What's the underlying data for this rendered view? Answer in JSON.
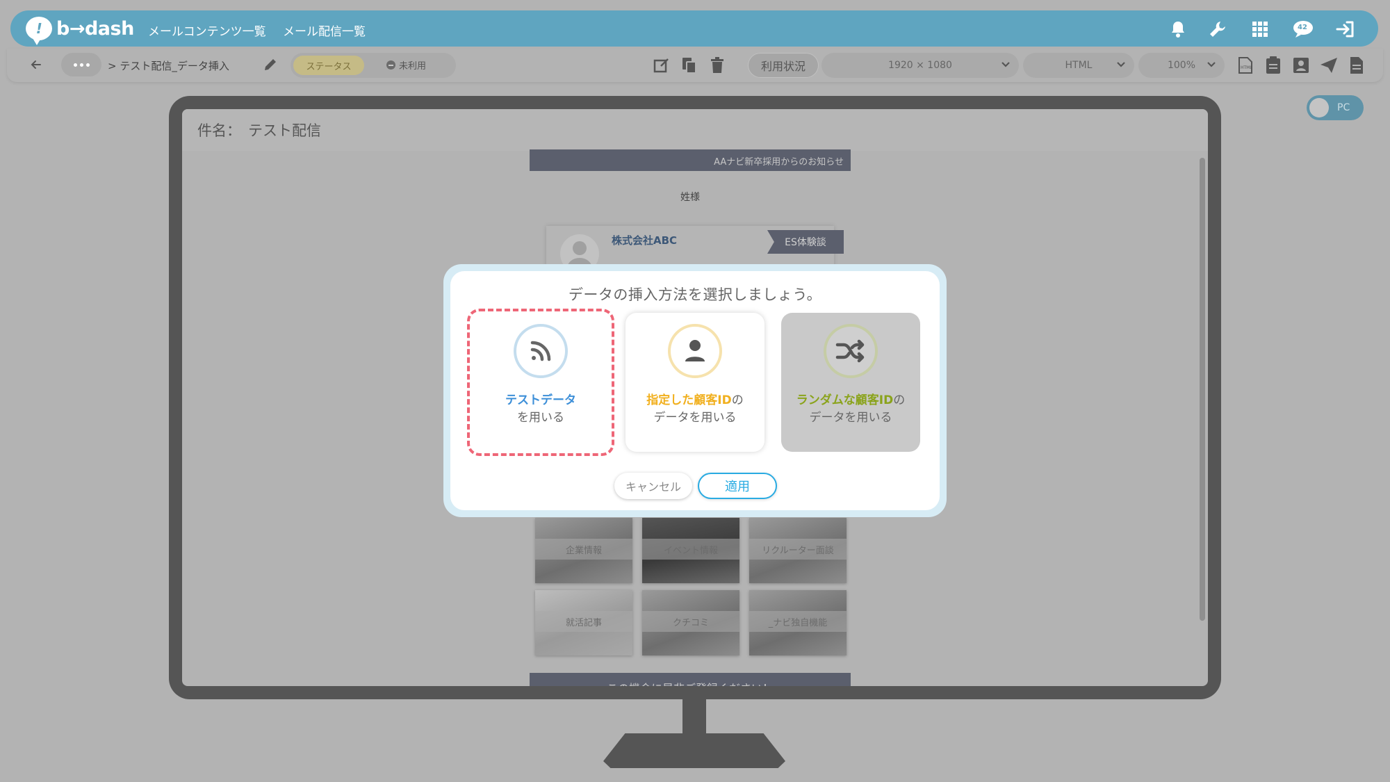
{
  "app": {
    "logo_text": "b→dash"
  },
  "nav": {
    "items": [
      {
        "label": "メールコンテンツ一覧"
      },
      {
        "label": "メール配信一覧"
      }
    ]
  },
  "topbar_icons": [
    "bell-icon",
    "wrench-icon",
    "apps-grid-icon",
    "chat-icon",
    "logout-icon"
  ],
  "chat_badge": "42",
  "toolbar": {
    "breadcrumb": "> テスト配信_データ挿入",
    "status_label": "ステータス",
    "status_value": "未利用",
    "usage_label": "利用状況",
    "resolution": "1920 × 1080",
    "format": "HTML",
    "zoom": "100%",
    "html_badge": "HTML"
  },
  "device_toggle": {
    "label": "PC"
  },
  "preview": {
    "subject_label": "件名：",
    "subject_value": "テスト配信",
    "email": {
      "header": "AAナビ新卒採用からのお知らせ",
      "greeting": "姓様",
      "company": "株式会社ABC",
      "tag": "ES体験談",
      "tiles": [
        {
          "label": "企業情報"
        },
        {
          "label": "イベント情報"
        },
        {
          "label": "リクルーター面談"
        },
        {
          "label": "就活記事"
        },
        {
          "label": "クチコミ"
        },
        {
          "label": "_ナビ独自機能"
        }
      ],
      "footer": "この機会に是非ご登録ください！"
    }
  },
  "modal": {
    "title": "データの挿入方法を選択しましょう。",
    "options": [
      {
        "highlight": "テストデータ",
        "rest": "",
        "line2": "を用いる",
        "icon": "rss-icon",
        "selected": true,
        "disabled": false
      },
      {
        "highlight": "指定した顧客ID",
        "rest": "の",
        "line2": "データを用いる",
        "icon": "user-icon",
        "selected": false,
        "disabled": false
      },
      {
        "highlight": "ランダムな顧客ID",
        "rest": "の",
        "line2": "データを用いる",
        "icon": "shuffle-icon",
        "selected": false,
        "disabled": true
      }
    ],
    "cancel_label": "キャンセル",
    "apply_label": "適用"
  },
  "colors": {
    "brand": "#5fa5c0",
    "accent_blue": "#29abe2",
    "option_blue": "#3d8fd8",
    "option_yellow": "#f1b01f",
    "option_olive": "#8aa31b",
    "selection_dash": "#ee6677"
  }
}
